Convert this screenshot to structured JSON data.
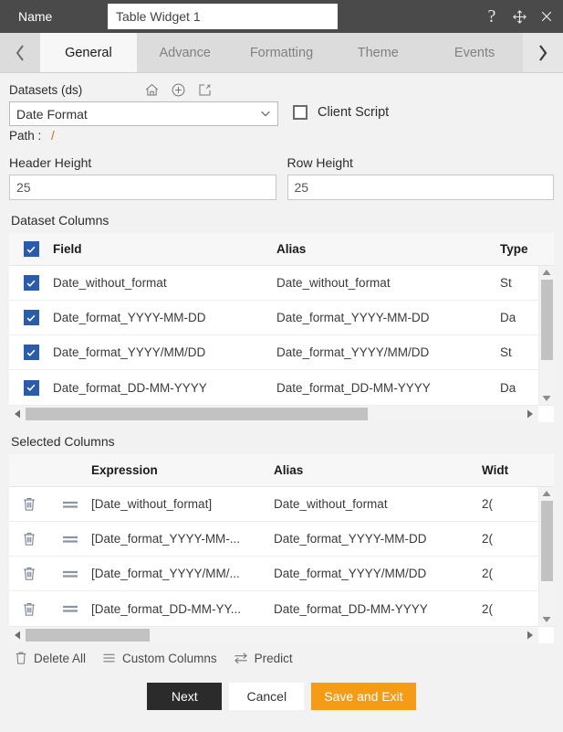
{
  "titlebar": {
    "name_label": "Name",
    "widget_name": "Table Widget 1",
    "widget_name_placeholder": "Table Widget 1",
    "help_icon": "question-mark-icon",
    "move_icon": "move-icon",
    "close_icon": "close-icon"
  },
  "tabbar": {
    "prev_label": "‹",
    "next_label": "›",
    "tabs": [
      {
        "label": "General",
        "active": true
      },
      {
        "label": "Advance",
        "active": false
      },
      {
        "label": "Formatting",
        "active": false
      },
      {
        "label": "Theme",
        "active": false
      },
      {
        "label": "Events",
        "active": false
      }
    ]
  },
  "general": {
    "datasets_label": "Datasets (ds)",
    "dataset_icons": [
      "home-icon",
      "add-circle-icon",
      "edit-icon"
    ],
    "dataset_selected": "Date Format",
    "client_script_label": "Client Script",
    "client_script_checked": false,
    "path_label": "Path :",
    "path_value": "/",
    "header_height_label": "Header Height",
    "header_height_value": "25",
    "row_height_label": "Row Height",
    "row_height_value": "25"
  },
  "dataset_columns": {
    "title": "Dataset Columns",
    "select_all_checked": true,
    "headers": {
      "field": "Field",
      "alias": "Alias",
      "type": "Type"
    },
    "rows": [
      {
        "checked": true,
        "field": "Date_without_format",
        "alias": "Date_without_format",
        "type": "St"
      },
      {
        "checked": true,
        "field": "Date_format_YYYY-MM-DD",
        "alias": "Date_format_YYYY-MM-DD",
        "type": "Da"
      },
      {
        "checked": true,
        "field": "Date_format_YYYY/MM/DD",
        "alias": "Date_format_YYYY/MM/DD",
        "type": "St"
      },
      {
        "checked": true,
        "field": "Date_format_DD-MM-YYYY",
        "alias": "Date_format_DD-MM-YYYY",
        "type": "Da"
      }
    ]
  },
  "selected_columns": {
    "title": "Selected Columns",
    "headers": {
      "expression": "Expression",
      "alias": "Alias",
      "width": "Widt"
    },
    "rows": [
      {
        "delete_icon": "trash-icon",
        "drag_icon": "drag-handle-icon",
        "expression": "[Date_without_format]",
        "alias": "Date_without_format",
        "width": "2("
      },
      {
        "delete_icon": "trash-icon",
        "drag_icon": "drag-handle-icon",
        "expression": "[Date_format_YYYY-MM-...",
        "alias": "Date_format_YYYY-MM-DD",
        "width": "2("
      },
      {
        "delete_icon": "trash-icon",
        "drag_icon": "drag-handle-icon",
        "expression": "[Date_format_YYYY/MM/...",
        "alias": "Date_format_YYYY/MM/DD",
        "width": "2("
      },
      {
        "delete_icon": "trash-icon",
        "drag_icon": "drag-handle-icon",
        "expression": "[Date_format_DD-MM-YY...",
        "alias": "Date_format_DD-MM-YYYY",
        "width": "2("
      }
    ]
  },
  "tools": {
    "delete_all": "Delete All",
    "custom_columns": "Custom Columns",
    "predict": "Predict"
  },
  "buttons": {
    "next": "Next",
    "cancel": "Cancel",
    "save_and_exit": "Save and Exit"
  },
  "colors": {
    "titlebar_bg": "#4a4a4a",
    "tabbar_bg": "#dcdcdc",
    "active_tab_bg": "#f7f7f7",
    "checkbox_blue": "#2b5cab",
    "accent_orange": "#f59b16",
    "next_dark": "#2b2b2b",
    "path_orange": "#c07020"
  }
}
